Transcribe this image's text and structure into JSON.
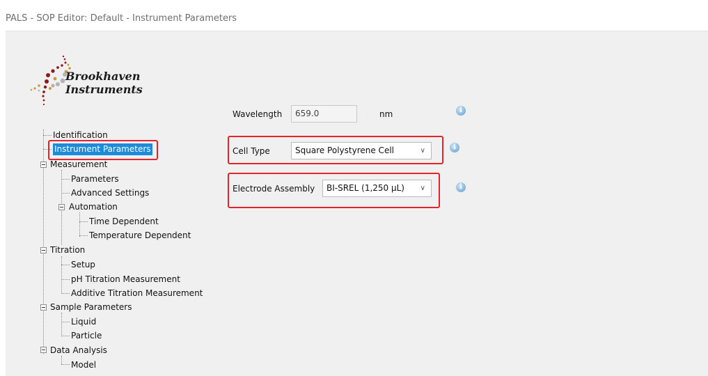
{
  "window": {
    "title": "PALS - SOP Editor: Default - Instrument Parameters"
  },
  "logo": {
    "line1": "Brookhaven",
    "line2": "Instruments"
  },
  "tree": [
    {
      "label": "Identification"
    },
    {
      "label": "Instrument Parameters",
      "selected": true
    },
    {
      "label": "Measurement"
    },
    {
      "label": "Parameters"
    },
    {
      "label": "Advanced Settings"
    },
    {
      "label": "Automation"
    },
    {
      "label": "Time Dependent"
    },
    {
      "label": "Temperature Dependent"
    },
    {
      "label": "Titration"
    },
    {
      "label": "Setup"
    },
    {
      "label": "pH Titration Measurement"
    },
    {
      "label": "Additive Titration Measurement"
    },
    {
      "label": "Sample Parameters"
    },
    {
      "label": "Liquid"
    },
    {
      "label": "Particle"
    },
    {
      "label": "Data Analysis"
    },
    {
      "label": "Model"
    }
  ],
  "form": {
    "wavelength": {
      "label": "Wavelength",
      "value": "659.0",
      "unit": "nm"
    },
    "cell_type": {
      "label": "Cell Type",
      "value": "Square Polystyrene Cell"
    },
    "electrode": {
      "label": "Electrode Assembly",
      "value": "BI-SREL (1,250 µL)"
    }
  },
  "icons": {
    "info": "i"
  },
  "colors": {
    "selection": "#1e8bd8",
    "highlight_box": "#e3242b",
    "panel_bg": "#f0f0f0"
  }
}
